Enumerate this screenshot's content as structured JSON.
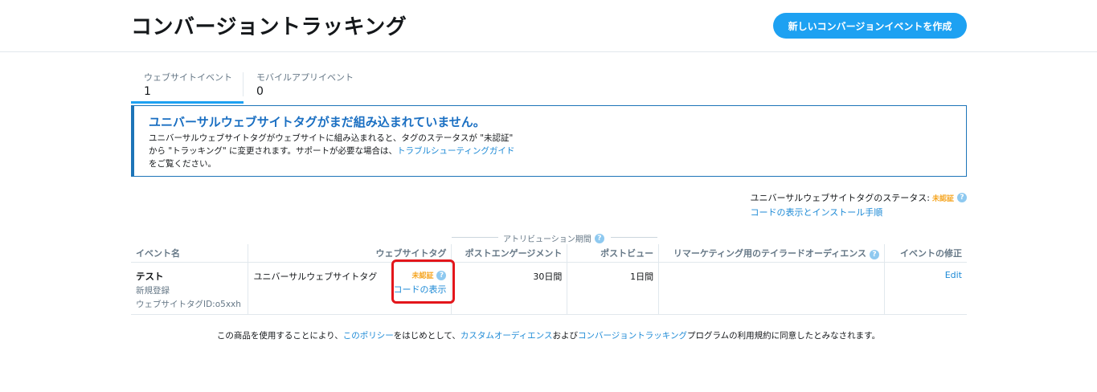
{
  "header": {
    "title": "コンバージョントラッキング",
    "create_button": "新しいコンバージョンイベントを作成"
  },
  "tabs": [
    {
      "label": "ウェブサイトイベント",
      "count": "1"
    },
    {
      "label": "モバイルアプリイベント",
      "count": "0"
    }
  ],
  "alert": {
    "title": "ユニバーサルウェブサイトタグがまだ組み込まれていません。",
    "body_1": "ユニバーサルウェブサイトタグがウェブサイトに組み込まれると、タグのステータスが \"未認証\" から \"トラッキング\" に変更されます。サポートが必要な場合は、",
    "link": "トラブルシューティングガイド",
    "body_2": "をご覧ください。"
  },
  "status": {
    "label": "ユニバーサルウェブサイトタグのステータス:",
    "value": "未認証",
    "help": "?",
    "install_link": "コードの表示とインストール手順"
  },
  "attribution": {
    "label": "アトリビューション期間",
    "help": "?"
  },
  "table": {
    "headers": {
      "name": "イベント名",
      "tag": "ウェブサイトタグ",
      "engagement": "ポストエンゲージメント",
      "view": "ポストビュー",
      "remarketing": "リマーケティング用のテイラードオーディエンス",
      "remarketing_help": "?",
      "edit": "イベントの修正"
    },
    "rows": [
      {
        "name": "テスト",
        "type": "新規登録",
        "tag_id": "ウェブサイトタグID:o5xxh",
        "tag_name": "ユニバーサルウェブサイトタグ",
        "tag_status": "未認証",
        "tag_help": "?",
        "tag_code": "コードの表示",
        "engagement": "30日間",
        "view": "1日間",
        "remarketing": "",
        "edit": "Edit"
      }
    ]
  },
  "footer": {
    "text_1": "この商品を使用することにより、",
    "link_1": "このポリシー",
    "text_2": "をはじめとして、",
    "link_2": "カスタムオーディエンス",
    "text_3": "および",
    "link_3": "コンバージョントラッキング",
    "text_4": "プログラムの利用規約に同意したとみなされます。"
  },
  "colors": {
    "accent": "#1da1f2",
    "alert_border": "#1d74b8",
    "warning": "#f5a623",
    "highlight": "#e3161b"
  }
}
